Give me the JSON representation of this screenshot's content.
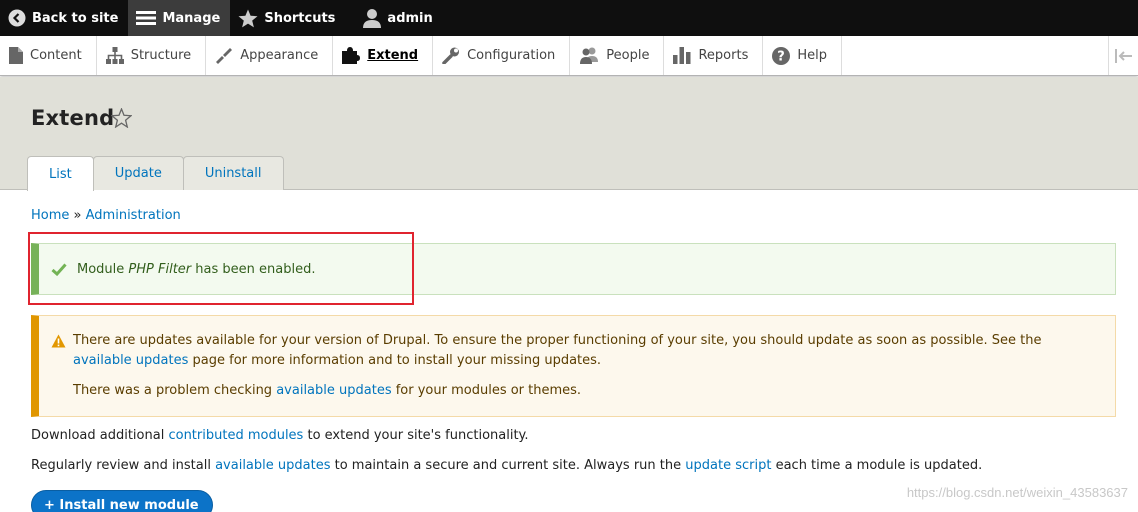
{
  "toolbar": {
    "back": "Back to site",
    "manage": "Manage",
    "shortcuts": "Shortcuts",
    "user": "admin"
  },
  "tray": {
    "items": [
      {
        "label": "Content",
        "icon": "file-icon"
      },
      {
        "label": "Structure",
        "icon": "structure-icon"
      },
      {
        "label": "Appearance",
        "icon": "paintbrush-icon"
      },
      {
        "label": "Extend",
        "icon": "puzzle-icon"
      },
      {
        "label": "Configuration",
        "icon": "wrench-icon"
      },
      {
        "label": "People",
        "icon": "people-icon"
      },
      {
        "label": "Reports",
        "icon": "bar-chart-icon"
      },
      {
        "label": "Help",
        "icon": "help-icon"
      }
    ]
  },
  "header": {
    "title": "Extend",
    "tabs": [
      "List",
      "Update",
      "Uninstall"
    ]
  },
  "breadcrumb": {
    "home": "Home",
    "sep": "»",
    "admin": "Administration"
  },
  "status_message": {
    "prefix": "Module",
    "module": "PHP Filter",
    "suffix": "has been enabled."
  },
  "warning": {
    "line1_a": "There are updates available for your version of Drupal. To ensure the proper functioning of your site, you should update as soon as possible. See the",
    "line1_link": "available updates",
    "line1_b": "page for more information and to install your missing updates.",
    "line2_a": "There was a problem checking",
    "line2_link": "available updates",
    "line2_b": "for your modules or themes."
  },
  "intro": {
    "p1_a": "Download additional",
    "p1_link": "contributed modules",
    "p1_b": "to extend your site's functionality.",
    "p2_a": "Regularly review and install",
    "p2_link1": "available updates",
    "p2_b": "to maintain a secure and current site. Always run the",
    "p2_link2": "update script",
    "p2_c": "each time a module is updated."
  },
  "install_button": "+ Install new module",
  "watermark": "https://blog.csdn.net/weixin_43583637",
  "colors": {
    "link": "#0074bd",
    "status_border": "#77b259",
    "warning_border": "#e09600",
    "highlight": "#e0242f"
  }
}
